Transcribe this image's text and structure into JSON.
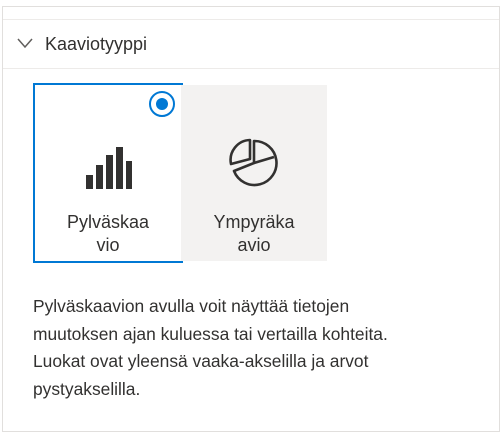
{
  "section": {
    "title": "Kaaviotyyppi",
    "expanded": true
  },
  "chart_types": [
    {
      "label_line1": "Pylväskaa",
      "label_line2": "vio",
      "icon": "bar-chart-icon",
      "selected": true
    },
    {
      "label_line1": "Ympyräka",
      "label_line2": "avio",
      "icon": "pie-chart-icon",
      "selected": false
    }
  ],
  "description": {
    "line1": "Pylväskaavion avulla voit näyttää tietojen",
    "line2": "muutoksen ajan kuluessa tai vertailla kohteita.",
    "line3": "Luokat ovat yleensä vaaka-akselilla ja arvot",
    "line4": "pystyakselilla."
  },
  "colors": {
    "accent": "#0078d4",
    "text": "#323130",
    "option_bg": "#f3f2f1",
    "border": "#e1dfdd"
  }
}
